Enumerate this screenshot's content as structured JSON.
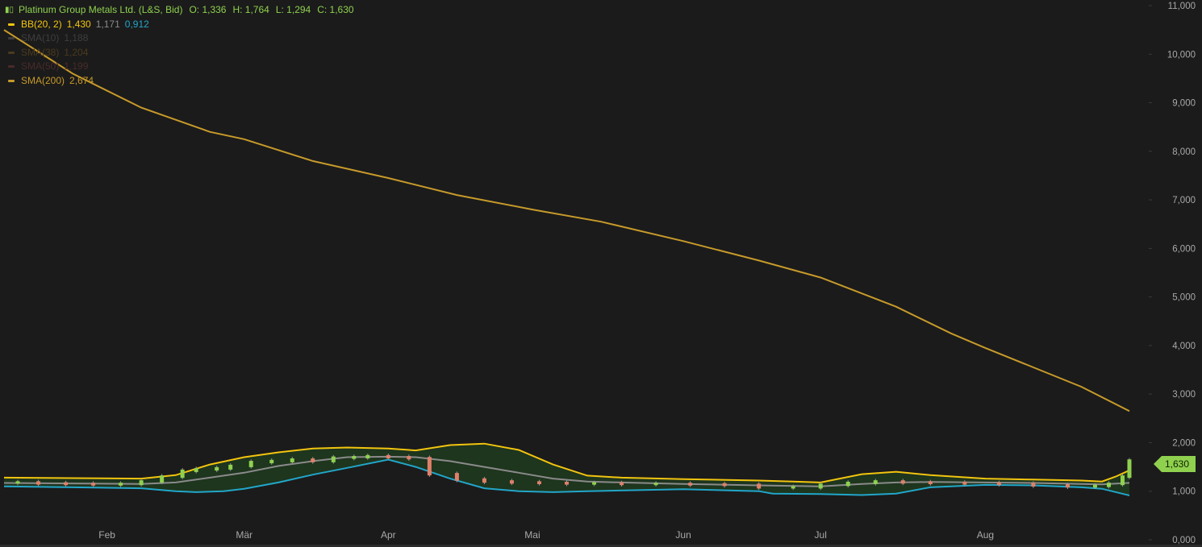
{
  "header": {
    "symbol_icon": "candle-chart-icon",
    "title": "Platinum Group Metals Ltd. (L&S, Bid)",
    "ohlc": {
      "open": "O: 1,336",
      "high": "H: 1,764",
      "low": "L: 1,294",
      "close": "C: 1,630"
    }
  },
  "legend": [
    {
      "label": "BB(20, 2)",
      "values": [
        "1,430",
        "1,171",
        "0,912"
      ],
      "colors": [
        "#f2c40f",
        "#8a8a8a",
        "#22a6c9"
      ]
    },
    {
      "label": "SMA(10)",
      "values": [
        "1,188"
      ],
      "colors": [
        "#3e3e3e"
      ]
    },
    {
      "label": "SMA(38)",
      "values": [
        "1,204"
      ],
      "colors": [
        "#4a3a1e"
      ]
    },
    {
      "label": "SMA(50)",
      "values": [
        "1,199"
      ],
      "colors": [
        "#4a2a2a"
      ]
    },
    {
      "label": "SMA(200)",
      "values": [
        "2,674"
      ],
      "colors": [
        "#c79a2a"
      ]
    }
  ],
  "last_price_badge": "1,630",
  "colors": {
    "background": "#1b1b1b",
    "bb_upper": "#f2c40f",
    "bb_middle": "#8a8a8a",
    "bb_lower": "#22a6c9",
    "bb_fill": "#1f3a1f",
    "sma200": "#c79a2a",
    "candle_up": "#8fd14f",
    "candle_down": "#e0806a"
  },
  "chart_data": {
    "type": "line",
    "ylim": [
      0,
      11000
    ],
    "y_ticks": [
      0,
      1000,
      2000,
      3000,
      4000,
      5000,
      6000,
      7000,
      8000,
      9000,
      10000,
      11000
    ],
    "y_tick_labels": [
      "0,000",
      "1,000",
      "2,000",
      "3,000",
      "4,000",
      "5,000",
      "6,000",
      "7,000",
      "8,000",
      "9,000",
      "10,000",
      "11,000"
    ],
    "x_months": [
      "Feb",
      "Mär",
      "Apr",
      "Mai",
      "Jun",
      "Jul",
      "Aug"
    ],
    "x_month_index": [
      15,
      35,
      56,
      77,
      99,
      119,
      143
    ],
    "x_range": [
      0,
      164
    ],
    "series": [
      {
        "key": "sma200",
        "label": "SMA(200)",
        "x": [
          0,
          10,
          20,
          30,
          35,
          45,
          56,
          66,
          77,
          87,
          99,
          110,
          119,
          130,
          138,
          143,
          150,
          157,
          164
        ],
        "values": [
          10500,
          9600,
          8900,
          8400,
          8250,
          7800,
          7450,
          7100,
          6800,
          6550,
          6150,
          5750,
          5400,
          4800,
          4250,
          3950,
          3550,
          3150,
          2650
        ]
      },
      {
        "key": "bb_upper",
        "label": "BB upper",
        "x": [
          0,
          10,
          20,
          25,
          30,
          35,
          40,
          45,
          50,
          56,
          60,
          65,
          70,
          75,
          80,
          85,
          90,
          99,
          110,
          115,
          119,
          125,
          130,
          135,
          143,
          150,
          157,
          160,
          162,
          164
        ],
        "values": [
          1280,
          1270,
          1260,
          1330,
          1550,
          1700,
          1800,
          1880,
          1900,
          1880,
          1840,
          1950,
          1980,
          1850,
          1550,
          1320,
          1280,
          1250,
          1220,
          1200,
          1180,
          1350,
          1400,
          1330,
          1260,
          1240,
          1220,
          1200,
          1300,
          1430
        ]
      },
      {
        "key": "bb_middle",
        "label": "BB middle",
        "x": [
          0,
          10,
          20,
          25,
          30,
          35,
          40,
          45,
          50,
          56,
          60,
          65,
          70,
          75,
          80,
          85,
          90,
          99,
          110,
          119,
          125,
          130,
          135,
          143,
          150,
          157,
          160,
          164
        ],
        "values": [
          1170,
          1160,
          1150,
          1180,
          1280,
          1380,
          1520,
          1620,
          1700,
          1710,
          1700,
          1620,
          1500,
          1380,
          1260,
          1200,
          1180,
          1150,
          1120,
          1100,
          1150,
          1180,
          1190,
          1180,
          1170,
          1150,
          1140,
          1171
        ]
      },
      {
        "key": "bb_lower",
        "label": "BB lower",
        "x": [
          0,
          10,
          20,
          25,
          28,
          32,
          35,
          40,
          45,
          50,
          56,
          60,
          65,
          70,
          75,
          80,
          85,
          99,
          110,
          112,
          119,
          125,
          130,
          135,
          143,
          150,
          157,
          160,
          164
        ],
        "values": [
          1100,
          1080,
          1060,
          1000,
          980,
          1000,
          1050,
          1180,
          1340,
          1480,
          1650,
          1500,
          1260,
          1060,
          1000,
          980,
          1000,
          1040,
          1000,
          950,
          940,
          920,
          950,
          1080,
          1130,
          1120,
          1080,
          1050,
          912
        ]
      },
      {
        "key": "candles",
        "label": "candles",
        "x": [
          2,
          5,
          9,
          13,
          17,
          20,
          23,
          26,
          28,
          31,
          33,
          36,
          39,
          42,
          45,
          48,
          51,
          53,
          56,
          59,
          62,
          66,
          70,
          74,
          78,
          82,
          86,
          90,
          95,
          100,
          105,
          110,
          115,
          119,
          123,
          127,
          131,
          135,
          140,
          145,
          150,
          155,
          159,
          161,
          163,
          164
        ],
        "values": [
          1180,
          1160,
          1150,
          1140,
          1150,
          1200,
          1300,
          1420,
          1450,
          1470,
          1520,
          1600,
          1620,
          1650,
          1620,
          1690,
          1700,
          1720,
          1700,
          1680,
          1350,
          1240,
          1200,
          1180,
          1170,
          1160,
          1160,
          1150,
          1150,
          1140,
          1130,
          1080,
          1080,
          1130,
          1170,
          1200,
          1180,
          1170,
          1160,
          1150,
          1120,
          1100,
          1110,
          1150,
          1300,
          1630
        ]
      }
    ]
  }
}
